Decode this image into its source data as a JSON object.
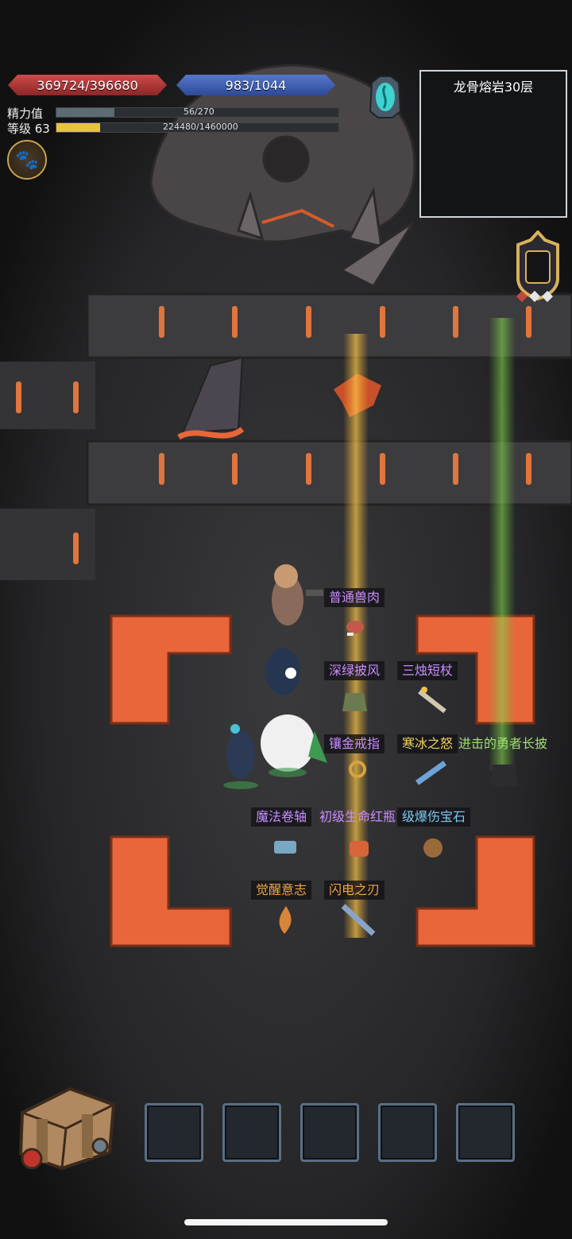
{
  "hud": {
    "hp_text": "369724/396680",
    "mp_text": "983/1044",
    "energy_label": "精力值",
    "energy_value_text": "56/270",
    "energy_fraction": 0.207,
    "level_label": "等级 63",
    "exp_value_text": "224480/1460000",
    "exp_fraction": 0.154,
    "pet_button_icon": "paw-icon",
    "portal_icon": "portal-crystal-icon"
  },
  "minimap": {
    "title": "龙骨熔岩30层"
  },
  "loot_labels": [
    {
      "id": "loot-common-meat",
      "text": "普通兽肉",
      "color": "#c88dff"
    },
    {
      "id": "loot-dark-green-cloak",
      "text": "深绿披风",
      "color": "#c88dff"
    },
    {
      "id": "loot-three-candle-staff",
      "text": "三烛短杖",
      "color": "#c88dff"
    },
    {
      "id": "loot-gilded-ring",
      "text": "镶金戒指",
      "color": "#c88dff"
    },
    {
      "id": "loot-frost-wrath",
      "text": "寒冰之怒",
      "color": "#f2d45a"
    },
    {
      "id": "loot-brave-cloak",
      "text": "进击的勇者长披",
      "color": "#9de070"
    },
    {
      "id": "loot-magic-scroll",
      "text": "魔法卷轴",
      "color": "#c88dff"
    },
    {
      "id": "loot-health-potion",
      "text": "初级生命红瓶",
      "color": "#c88dff"
    },
    {
      "id": "loot-crit-gem",
      "text": "级爆伤宝石",
      "color": "#7ccaf0"
    },
    {
      "id": "loot-awakening-will",
      "text": "觉醒意志",
      "color": "#f0a540"
    },
    {
      "id": "loot-lightning-blade",
      "text": "闪电之刃",
      "color": "#f0a540"
    }
  ],
  "inventory": {
    "bag_icon": "backpack-icon",
    "slot_count": 5
  },
  "colors": {
    "hp": "#c23b3b",
    "mp": "#3f5fb5",
    "energy_fill": "#5d6b75",
    "exp_fill": "#e7c43e",
    "lava": "#e8663a",
    "minimap_room": "#3c6f7a"
  }
}
